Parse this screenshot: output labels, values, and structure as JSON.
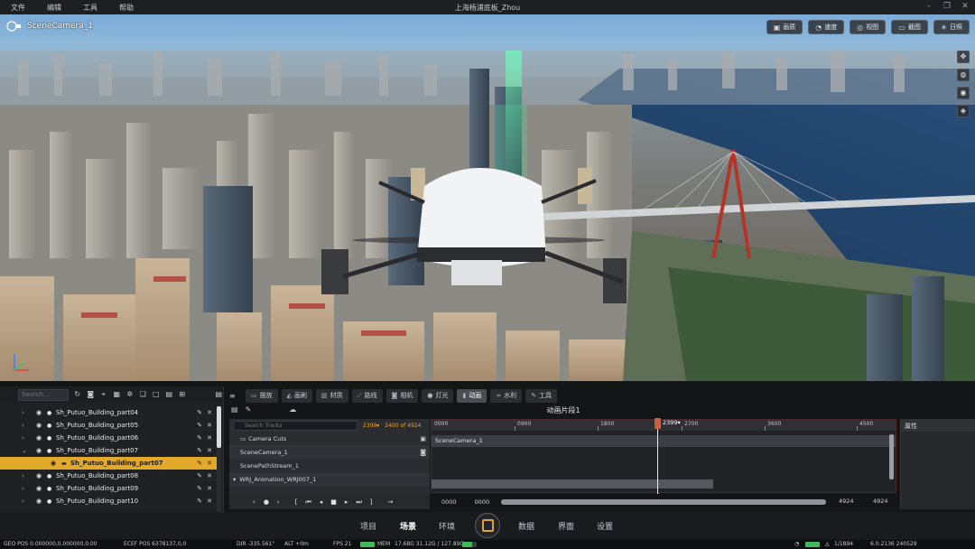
{
  "menubar": {
    "items": [
      "文件",
      "编辑",
      "工具",
      "帮助"
    ],
    "title": "上海杨浦底板_Zhou"
  },
  "viewport": {
    "camera_label": "SceneCamera_1",
    "toolbar": [
      {
        "label": "画质",
        "icon": "image-icon"
      },
      {
        "label": "速度",
        "icon": "speed-icon"
      },
      {
        "label": "视图",
        "icon": "view-icon"
      },
      {
        "label": "截图",
        "icon": "screenshot-icon"
      },
      {
        "label": "日照",
        "icon": "sun-icon"
      }
    ]
  },
  "outliner": {
    "search_placeholder": "Search...",
    "items": [
      {
        "label": "Sh_Putuo_Building_part04",
        "selected": false
      },
      {
        "label": "Sh_Putuo_Building_part05",
        "selected": false
      },
      {
        "label": "Sh_Putuo_Building_part06",
        "selected": false
      },
      {
        "label": "Sh_Putuo_Building_part07",
        "selected": false
      },
      {
        "label": "Sh_Putuo_Building_part07",
        "selected": true
      },
      {
        "label": "Sh_Putuo_Building_part08",
        "selected": false
      },
      {
        "label": "Sh_Putuo_Building_part09",
        "selected": false
      },
      {
        "label": "Sh_Putuo_Building_part10",
        "selected": false
      }
    ]
  },
  "tabs": [
    {
      "label": "摆放",
      "active": false
    },
    {
      "label": "画刷",
      "active": false
    },
    {
      "label": "材质",
      "active": false
    },
    {
      "label": "路线",
      "active": false
    },
    {
      "label": "相机",
      "active": false
    },
    {
      "label": "灯光",
      "active": false
    },
    {
      "label": "动画",
      "active": true
    },
    {
      "label": "水利",
      "active": false
    },
    {
      "label": "工具",
      "active": false
    }
  ],
  "sequencer": {
    "title": "动画片段1",
    "search_placeholder": "Search Tracks",
    "current_frame": "2399",
    "frame_info": "2400 of 4924",
    "tracks": [
      "Camera Cuts",
      "SceneCamera_1",
      "ScenePathStream_1",
      "WRJ_Animation_WRJ007_1"
    ],
    "ruler_ticks": [
      "0000",
      "0900",
      "1800",
      "2700",
      "3600",
      "4500"
    ],
    "playhead_label": "2399",
    "camera_cut_clip": "SceneCamera_1",
    "range_start_a": "0000",
    "range_start_b": "0000",
    "range_end_a": "4924",
    "range_end_b": "4924"
  },
  "properties": {
    "title": "属性"
  },
  "bottom_nav": {
    "items": [
      {
        "label": "项目",
        "active": false
      },
      {
        "label": "场景",
        "active": true
      },
      {
        "label": "环境",
        "active": false
      },
      {
        "label": "数据",
        "active": false
      },
      {
        "label": "界面",
        "active": false
      },
      {
        "label": "设置",
        "active": false
      }
    ]
  },
  "statusbar": {
    "geo_pos": "GEO POS  0.000000,0.000000,0.00",
    "ecef_pos": "ECEF POS  6378137,0,0",
    "dir": "DIR  -335.561°",
    "alt": "ALT  +0m",
    "fps": "FPS  21",
    "mem_label": "MEM",
    "mem_value": "17.68G  31.12G / 127.89G",
    "page": "1/1894",
    "version": "6.0.2136 240529"
  }
}
